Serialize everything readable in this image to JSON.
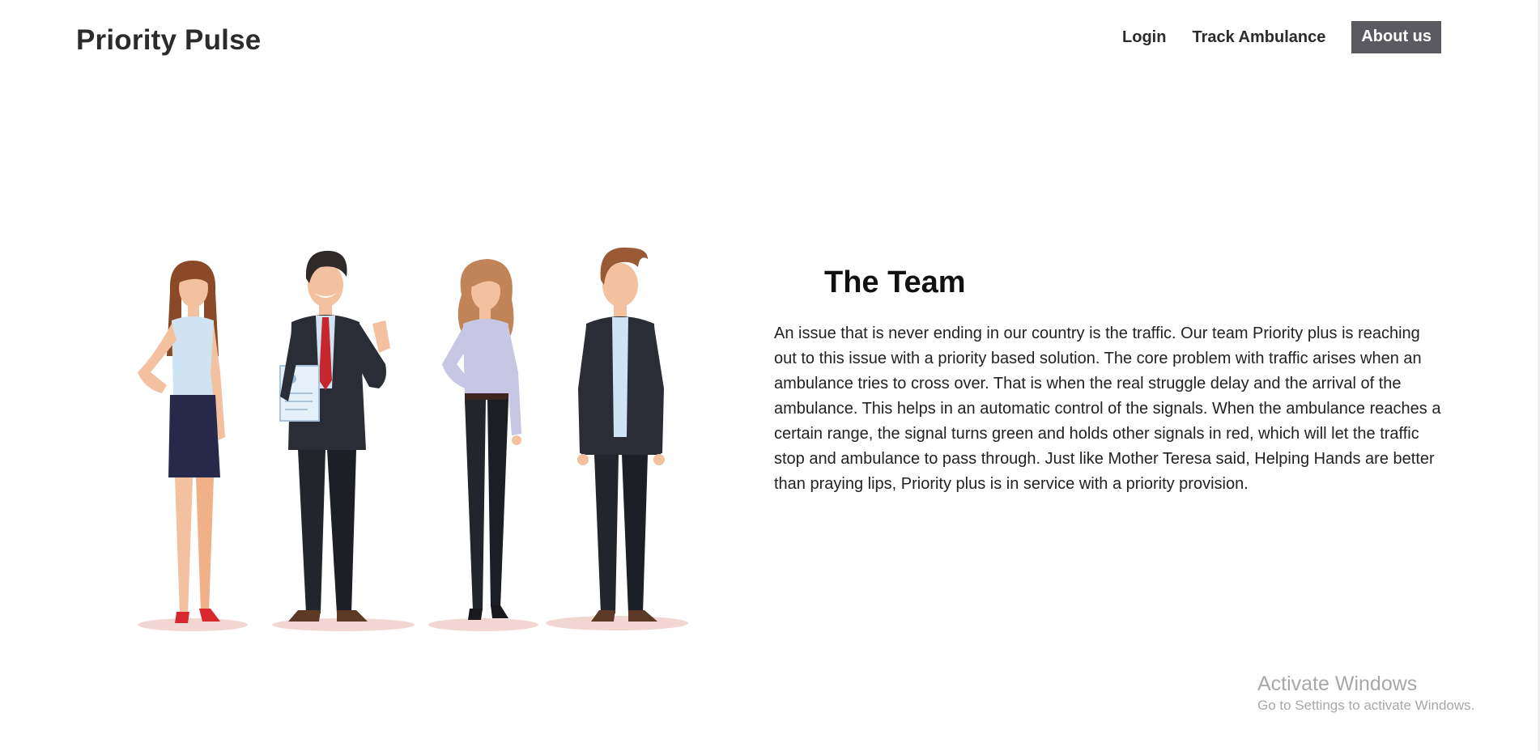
{
  "header": {
    "brand": "Priority Pulse",
    "nav": {
      "login": "Login",
      "track": "Track Ambulance",
      "about": "About us"
    }
  },
  "main": {
    "title": "The Team",
    "body": "An issue that is never ending in our country is the traffic. Our team Priority plus is reaching out to this issue with a priority based solution. The core problem with traffic arises when an ambulance tries to cross over. That is when the real struggle delay and the arrival of the ambulance. This helps in an automatic control of the signals. When the ambulance reaches a certain range, the signal turns green and holds other signals in red, which will let the traffic stop and ambulance to pass through. Just like Mother Teresa said, Helping Hands are better than praying lips, Priority plus is in service with a priority provision."
  },
  "overlay": {
    "activate_title": "Activate Windows",
    "activate_sub": "Go to Settings to activate Windows."
  },
  "colors": {
    "active_nav_bg": "#5a5a60",
    "suit": "#2a2d36",
    "shirt": "#cfe3f2",
    "blouse": "#c7c6e4",
    "skirt": "#26294a",
    "hair_dark": "#2f2a28",
    "hair_brown": "#8a4a28",
    "hair_light": "#c08458",
    "skin": "#f3c19f",
    "shadow": "#f1d6d2",
    "watermark": "#a8a8a8"
  }
}
